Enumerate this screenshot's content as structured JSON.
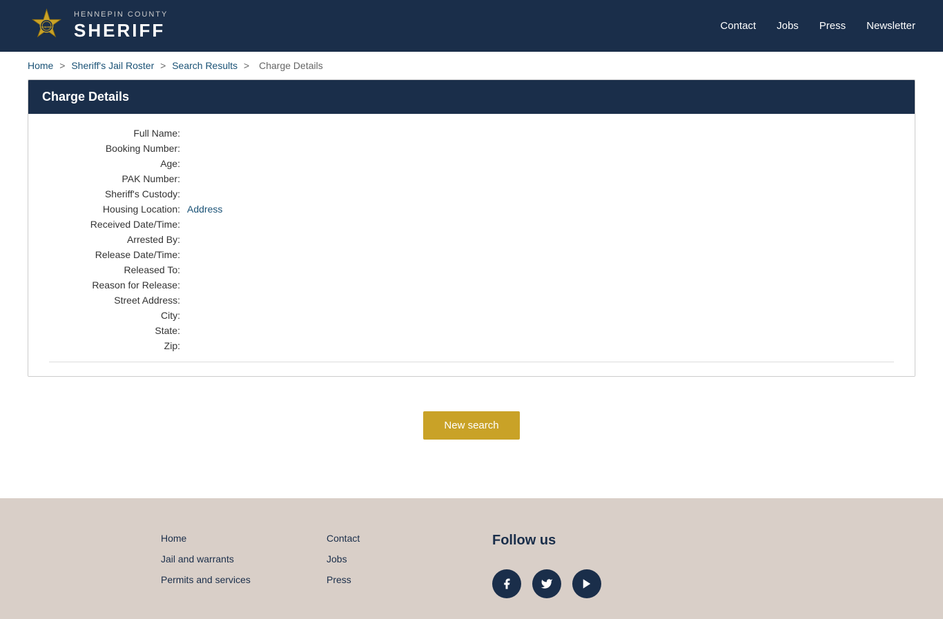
{
  "header": {
    "county": "HENNEPIN COUNTY",
    "title": "SHERIFF",
    "nav": [
      {
        "label": "Contact",
        "href": "#"
      },
      {
        "label": "Jobs",
        "href": "#"
      },
      {
        "label": "Press",
        "href": "#"
      },
      {
        "label": "Newsletter",
        "href": "#"
      }
    ]
  },
  "breadcrumb": {
    "items": [
      {
        "label": "Home",
        "href": "#"
      },
      {
        "label": "Sheriff's Jail Roster",
        "href": "#"
      },
      {
        "label": "Search Results",
        "href": "#"
      },
      {
        "label": "Charge Details",
        "href": null
      }
    ]
  },
  "card": {
    "title": "Charge Details",
    "fields": [
      {
        "label": "Full Name:",
        "value": "",
        "link": false
      },
      {
        "label": "Booking Number:",
        "value": "",
        "link": false
      },
      {
        "label": "Age:",
        "value": "",
        "link": false
      },
      {
        "label": "PAK Number:",
        "value": "",
        "link": false
      },
      {
        "label": "Sheriff's Custody:",
        "value": "",
        "link": false
      },
      {
        "label": "Housing Location:",
        "value": "Address",
        "link": true
      },
      {
        "label": "Received Date/Time:",
        "value": "",
        "link": false
      },
      {
        "label": "Arrested By:",
        "value": "",
        "link": false
      },
      {
        "label": "Release Date/Time:",
        "value": "",
        "link": false
      },
      {
        "label": "Released To:",
        "value": "",
        "link": false
      },
      {
        "label": "Reason for Release:",
        "value": "",
        "link": false
      },
      {
        "label": "Street Address:",
        "value": "",
        "link": false
      },
      {
        "label": "City:",
        "value": "",
        "link": false
      },
      {
        "label": "State:",
        "value": "",
        "link": false
      },
      {
        "label": "Zip:",
        "value": "",
        "link": false
      }
    ]
  },
  "button": {
    "label": "New search"
  },
  "footer": {
    "col1": [
      {
        "label": "Home",
        "href": "#"
      },
      {
        "label": "Jail and warrants",
        "href": "#"
      },
      {
        "label": "Permits and services",
        "href": "#"
      }
    ],
    "col2": [
      {
        "label": "Contact",
        "href": "#"
      },
      {
        "label": "Jobs",
        "href": "#"
      },
      {
        "label": "Press",
        "href": "#"
      }
    ],
    "follow": {
      "title": "Follow us",
      "social": [
        {
          "name": "Facebook",
          "icon": "f",
          "href": "#"
        },
        {
          "name": "Twitter",
          "icon": "t",
          "href": "#"
        },
        {
          "name": "YouTube",
          "icon": "▶",
          "href": "#"
        }
      ]
    }
  }
}
